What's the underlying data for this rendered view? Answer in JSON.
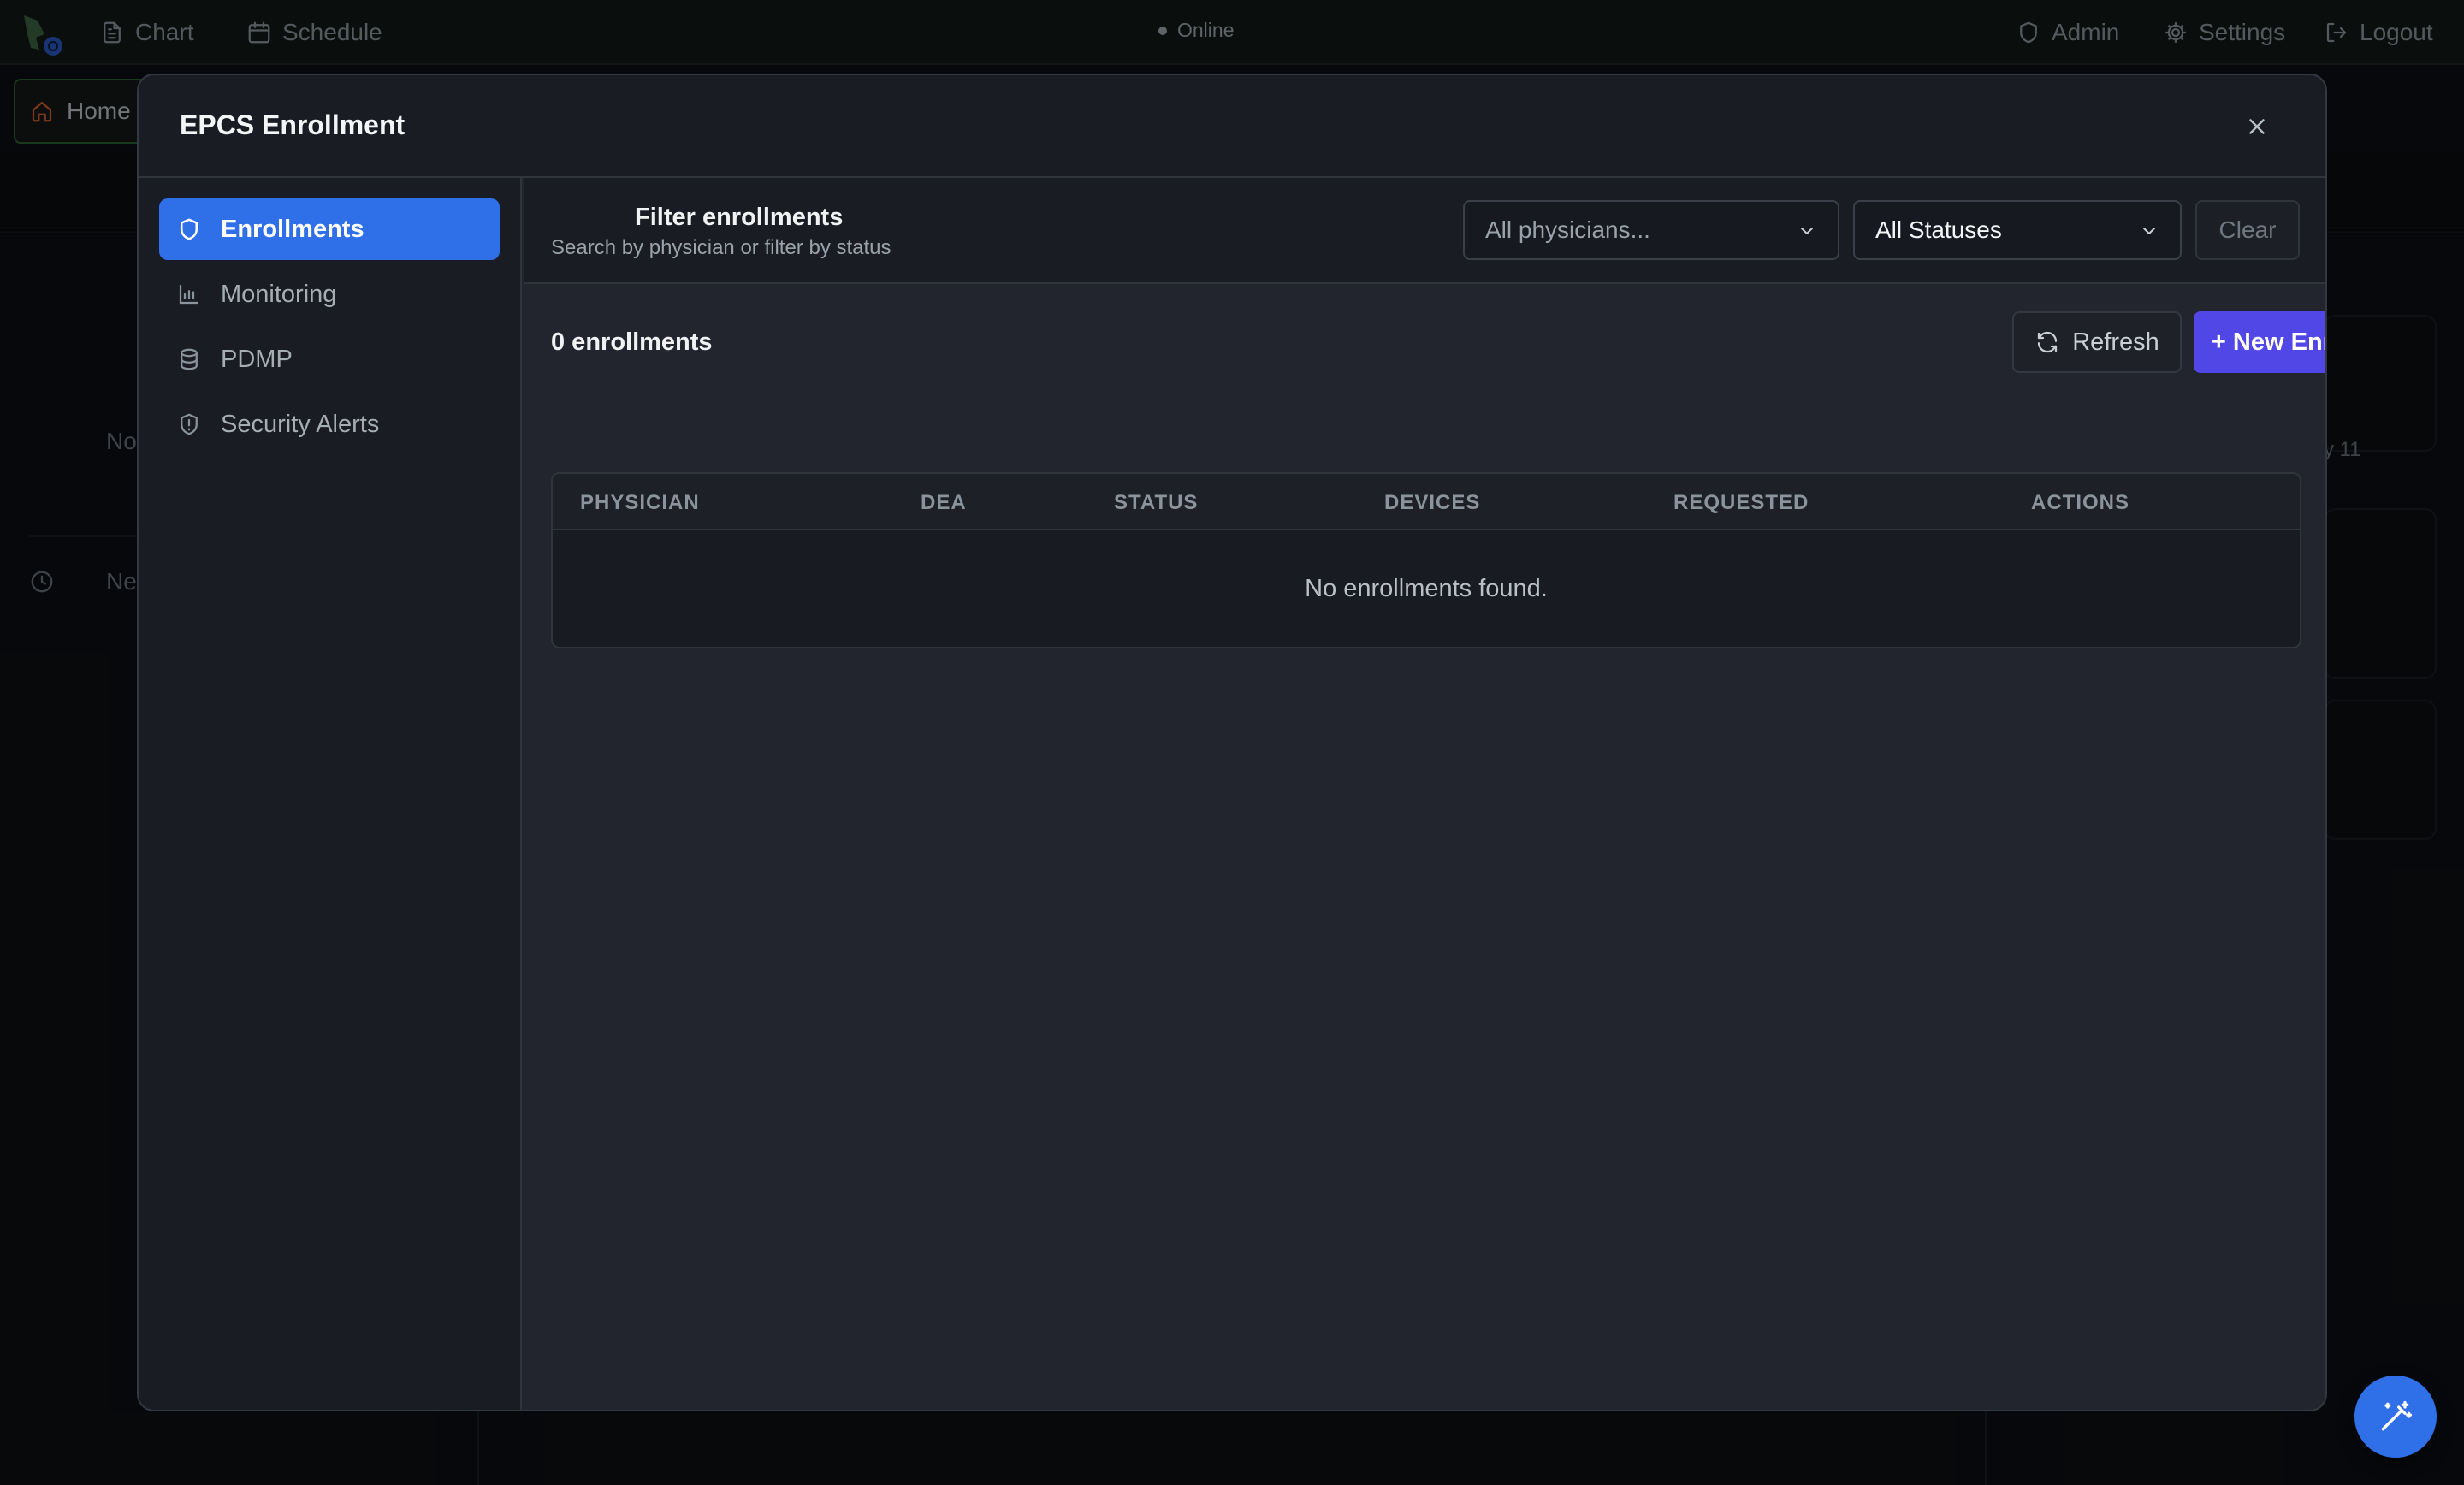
{
  "topbar": {
    "nav": [
      {
        "label": "Chart",
        "icon": "document-icon"
      },
      {
        "label": "Schedule",
        "icon": "calendar-icon"
      }
    ],
    "status": "Online",
    "right": [
      {
        "label": "Admin",
        "icon": "shield-icon"
      },
      {
        "label": "Settings",
        "icon": "gear-icon"
      },
      {
        "label": "Logout",
        "icon": "logout-icon"
      }
    ]
  },
  "background": {
    "home_tab": "Home",
    "fragment_no": "No",
    "fragment_next": "Next C",
    "fragment_date": "y 11"
  },
  "modal": {
    "title": "EPCS Enrollment",
    "sidebar": [
      {
        "label": "Enrollments",
        "icon": "shield-icon",
        "active": true
      },
      {
        "label": "Monitoring",
        "icon": "bar-chart-icon",
        "active": false
      },
      {
        "label": "PDMP",
        "icon": "database-icon",
        "active": false
      },
      {
        "label": "Security Alerts",
        "icon": "shield-alert-icon",
        "active": false
      }
    ],
    "filter": {
      "title": "Filter enrollments",
      "subtitle": "Search by physician or filter by status",
      "physician_placeholder": "All physicians...",
      "status_value": "All Statuses",
      "clear_label": "Clear"
    },
    "list": {
      "count_label": "0 enrollments",
      "refresh_label": "Refresh",
      "new_label": "+ New Enrollment",
      "columns": [
        "PHYSICIAN",
        "DEA",
        "STATUS",
        "DEVICES",
        "REQUESTED",
        "ACTIONS"
      ],
      "empty_message": "No enrollments found."
    }
  },
  "colors": {
    "accent_blue": "#2f6fe8",
    "new_button": "#5146e6",
    "modal_bg": "#22252d",
    "panel_bg": "#191c23"
  }
}
